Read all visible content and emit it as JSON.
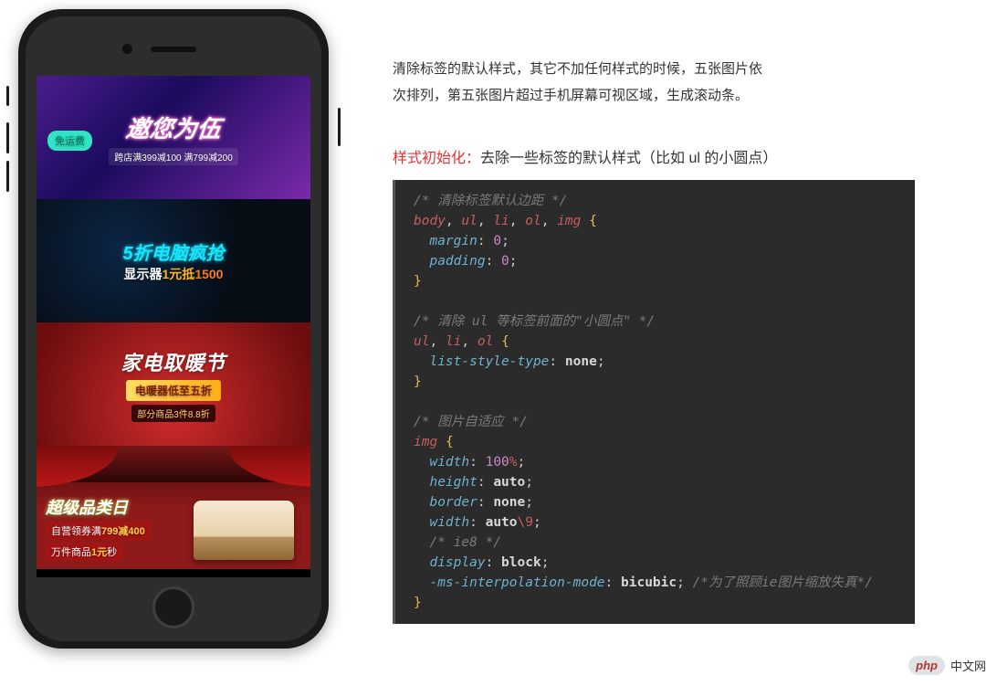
{
  "desc": {
    "line1": "清除标签的默认样式，其它不加任何样式的时候，五张图片依",
    "line2": "次排列，第五张图片超过手机屏幕可视区域，生成滚动条。"
  },
  "subhead": {
    "red": "样式初始化：",
    "gray": "去除一些标签的默认样式（比如 ul 的小圆点）"
  },
  "code": {
    "selectors1": [
      "body",
      "ul",
      "li",
      "ol",
      "img"
    ],
    "selectors2": [
      "ul",
      "li",
      "ol"
    ],
    "selectors3": [
      "img"
    ],
    "comments": {
      "c1": "/* 清除标签默认边距 */",
      "c2": "/* 清除 ul 等标签前面的\"小圆点\" */",
      "c3": "/* 图片自适应 */",
      "c4": "/* ie8 */",
      "c5": "/*为了照顾ie图片缩放失真*/"
    },
    "props": {
      "margin": "margin",
      "padding": "padding",
      "lst": "list-style-type",
      "width": "width",
      "height": "height",
      "border": "border",
      "display": "display",
      "msi": "-ms-interpolation-mode"
    },
    "vals": {
      "zero": "0",
      "none": "none",
      "hundred": "100",
      "pct": "%",
      "auto": "auto",
      "widthHack": "\\9",
      "block": "block",
      "bicubic": "bicubic"
    }
  },
  "banners": {
    "b1": {
      "badge": "免运费",
      "title": "邀您为伍",
      "promo": "跨店满399减100  满799减200"
    },
    "b2": {
      "corner": "//.//",
      "title": "5折电脑疯抢",
      "sub_pre": "显示器",
      "sub_mid": "1元抵",
      "sub_num": "1500"
    },
    "b3": {
      "title": "家电取暖节",
      "bar": "电暖器低至五折",
      "chip": "部分商品3件8.8折"
    },
    "b4": {
      "title": "超级品类日",
      "bar_a": "自营领券满",
      "bar_num": "799减400",
      "bar2_a": "万件商品",
      "bar2_num": "1元",
      "bar2_b": "秒"
    }
  },
  "watermark": {
    "logo": "php",
    "text": "中文网"
  }
}
